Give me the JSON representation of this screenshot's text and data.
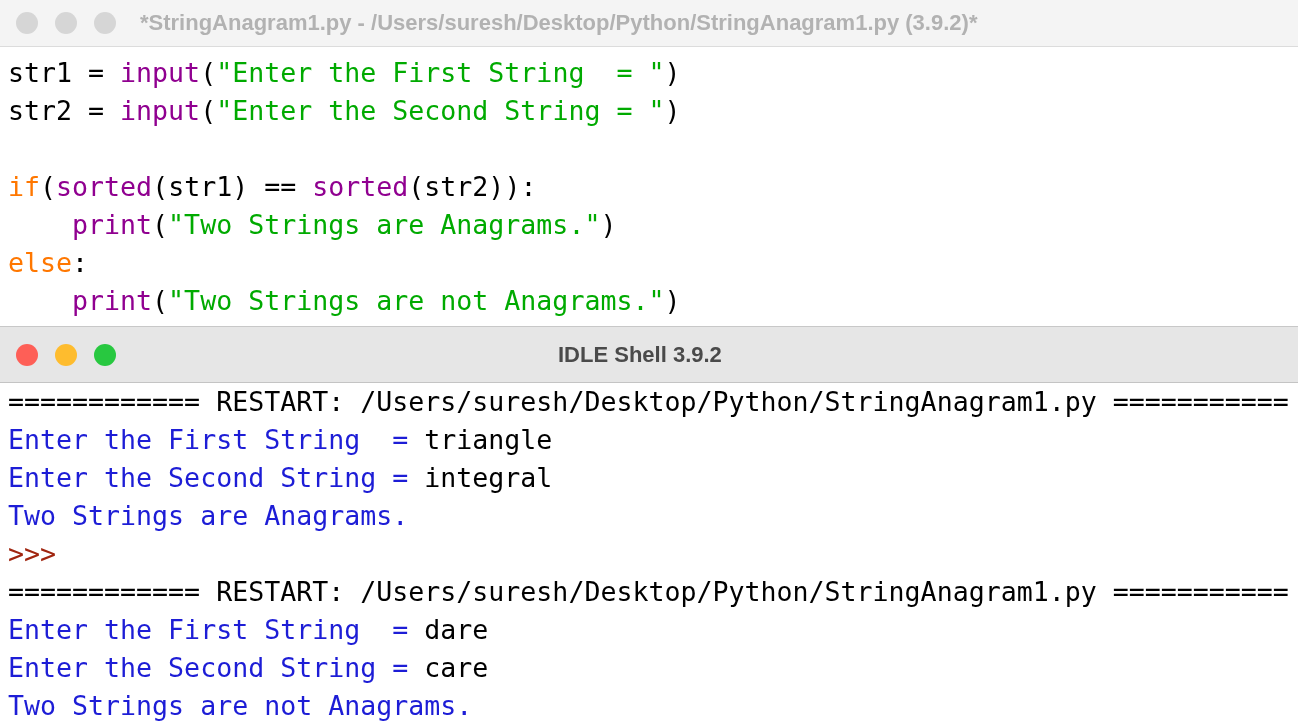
{
  "editor_window": {
    "title": "*StringAnagram1.py - /Users/suresh/Desktop/Python/StringAnagram1.py (3.9.2)*",
    "active": false,
    "code_lines": [
      {
        "kind": "code",
        "tokens": [
          {
            "kind": "plain",
            "text": "str1 = "
          },
          {
            "kind": "builtin",
            "text": "input"
          },
          {
            "kind": "plain",
            "text": "("
          },
          {
            "kind": "string",
            "text": "\"Enter the First String  = \""
          },
          {
            "kind": "plain",
            "text": ")"
          }
        ]
      },
      {
        "kind": "code",
        "tokens": [
          {
            "kind": "plain",
            "text": "str2 = "
          },
          {
            "kind": "builtin",
            "text": "input"
          },
          {
            "kind": "plain",
            "text": "("
          },
          {
            "kind": "string",
            "text": "\"Enter the Second String = \""
          },
          {
            "kind": "plain",
            "text": ")"
          }
        ]
      },
      {
        "kind": "blank"
      },
      {
        "kind": "code",
        "tokens": [
          {
            "kind": "keyword",
            "text": "if"
          },
          {
            "kind": "plain",
            "text": "("
          },
          {
            "kind": "builtin",
            "text": "sorted"
          },
          {
            "kind": "plain",
            "text": "(str1) == "
          },
          {
            "kind": "builtin",
            "text": "sorted"
          },
          {
            "kind": "plain",
            "text": "(str2)):"
          }
        ]
      },
      {
        "kind": "code",
        "indented": true,
        "tokens": [
          {
            "kind": "builtin",
            "text": "print"
          },
          {
            "kind": "plain",
            "text": "("
          },
          {
            "kind": "string",
            "text": "\"Two Strings are Anagrams.\""
          },
          {
            "kind": "plain",
            "text": ")"
          }
        ]
      },
      {
        "kind": "code",
        "tokens": [
          {
            "kind": "keyword",
            "text": "else"
          },
          {
            "kind": "plain",
            "text": ":"
          }
        ]
      },
      {
        "kind": "code",
        "indented": true,
        "tokens": [
          {
            "kind": "builtin",
            "text": "print"
          },
          {
            "kind": "plain",
            "text": "("
          },
          {
            "kind": "string",
            "text": "\"Two Strings are not Anagrams.\""
          },
          {
            "kind": "plain",
            "text": ")"
          }
        ]
      }
    ]
  },
  "shell_window": {
    "title": "IDLE Shell 3.9.2",
    "active": true,
    "lines": [
      {
        "segments": [
          {
            "kind": "restart",
            "text": "============ RESTART: /Users/suresh/Desktop/Python/StringAnagram1.py ==========="
          }
        ]
      },
      {
        "segments": [
          {
            "kind": "stdout",
            "text": "Enter the First String  = "
          },
          {
            "kind": "stdin",
            "text": "triangle"
          }
        ]
      },
      {
        "segments": [
          {
            "kind": "stdout",
            "text": "Enter the Second String = "
          },
          {
            "kind": "stdin",
            "text": "integral"
          }
        ]
      },
      {
        "segments": [
          {
            "kind": "stdout",
            "text": "Two Strings are Anagrams."
          }
        ]
      },
      {
        "segments": [
          {
            "kind": "prompt",
            "text": ">>>"
          }
        ]
      },
      {
        "segments": [
          {
            "kind": "restart",
            "text": "============ RESTART: /Users/suresh/Desktop/Python/StringAnagram1.py ==========="
          }
        ]
      },
      {
        "segments": [
          {
            "kind": "stdout",
            "text": "Enter the First String  = "
          },
          {
            "kind": "stdin",
            "text": "dare"
          }
        ]
      },
      {
        "segments": [
          {
            "kind": "stdout",
            "text": "Enter the Second String = "
          },
          {
            "kind": "stdin",
            "text": "care"
          }
        ]
      },
      {
        "segments": [
          {
            "kind": "stdout",
            "text": "Two Strings are not Anagrams."
          }
        ]
      }
    ]
  }
}
